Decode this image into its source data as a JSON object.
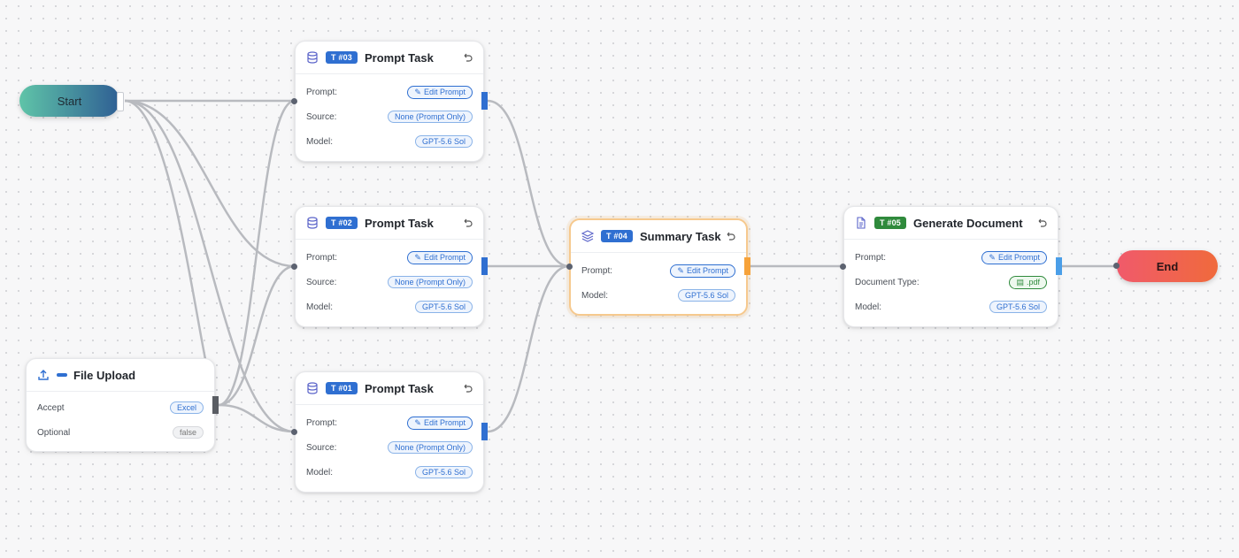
{
  "start": {
    "label": "Start"
  },
  "end": {
    "label": "End"
  },
  "upload": {
    "title": "File Upload",
    "rows": [
      {
        "label": "Accept",
        "value": "Excel"
      },
      {
        "label": "Optional",
        "value": "false"
      }
    ]
  },
  "task03": {
    "badge": "T #03",
    "title": "Prompt Task",
    "rows": [
      {
        "label": "Prompt:",
        "value": "Edit Prompt"
      },
      {
        "label": "Source:",
        "value": "None (Prompt Only)"
      },
      {
        "label": "Model:",
        "value": "GPT-5.6 Sol"
      }
    ]
  },
  "task02": {
    "badge": "T #02",
    "title": "Prompt Task",
    "rows": [
      {
        "label": "Prompt:",
        "value": "Edit Prompt"
      },
      {
        "label": "Source:",
        "value": "None (Prompt Only)"
      },
      {
        "label": "Model:",
        "value": "GPT-5.6 Sol"
      }
    ]
  },
  "task01": {
    "badge": "T #01",
    "title": "Prompt Task",
    "rows": [
      {
        "label": "Prompt:",
        "value": "Edit Prompt"
      },
      {
        "label": "Source:",
        "value": "None (Prompt Only)"
      },
      {
        "label": "Model:",
        "value": "GPT-5.6 Sol"
      }
    ]
  },
  "task04": {
    "badge": "T #04",
    "title": "Summary Task",
    "rows": [
      {
        "label": "Prompt:",
        "value": "Edit Prompt"
      },
      {
        "label": "Model:",
        "value": "GPT-5.6 Sol"
      }
    ]
  },
  "task05": {
    "badge": "T #05",
    "title": "Generate Document",
    "rows": [
      {
        "label": "Prompt:",
        "value": "Edit Prompt"
      },
      {
        "label": "Document Type:",
        "value": ".pdf"
      },
      {
        "label": "Model:",
        "value": "GPT-5.6 Sol"
      }
    ]
  },
  "colors": {
    "accent": "#2f6fd1",
    "summary": "#f6a23a",
    "doc": "#2f8a3c",
    "start_from": "#5fc4a8",
    "start_to": "#2f5f94",
    "end_from": "#f05a6b",
    "end_to": "#f06a3c",
    "edge": "#b8babf"
  }
}
